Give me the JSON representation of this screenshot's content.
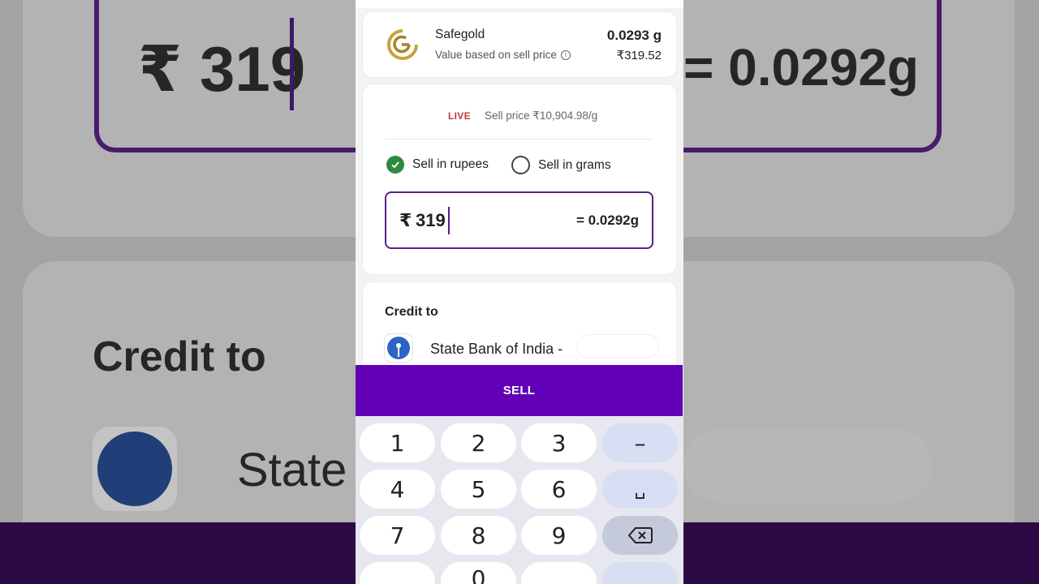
{
  "holding": {
    "name": "Safegold",
    "subtitle": "Value based on sell price",
    "info_icon": "info-circle-icon",
    "grams": "0.0293 g",
    "value": "₹319.52"
  },
  "sell": {
    "live_label": "LIVE",
    "sell_price": "Sell price ₹10,904.98/g",
    "options": [
      {
        "label": "Sell in rupees",
        "selected": true
      },
      {
        "label": "Sell in grams",
        "selected": false
      }
    ],
    "currency_symbol": "₹",
    "amount": "319",
    "grams_equivalent": "= 0.0292g"
  },
  "credit": {
    "title": "Credit to",
    "bank": "State Bank of India -"
  },
  "sell_button": "SELL",
  "keypad": {
    "row1": [
      "1",
      "2",
      "3",
      "–"
    ],
    "row2": [
      "4",
      "5",
      "6",
      "␣"
    ],
    "row3": [
      "7",
      "8",
      "9"
    ],
    "backspace_icon": "backspace-icon",
    "partial_key": "0"
  },
  "background": {
    "amount": "₹ 319",
    "grams": "= 0.0292g",
    "credit_title": "Credit to",
    "bank_partial": "State"
  },
  "colors": {
    "accent": "#6200b8",
    "input_border": "#5b1f86",
    "selected_radio": "#2e8b3e",
    "live": "#c23b3b",
    "sbi": "#2b65c4"
  }
}
